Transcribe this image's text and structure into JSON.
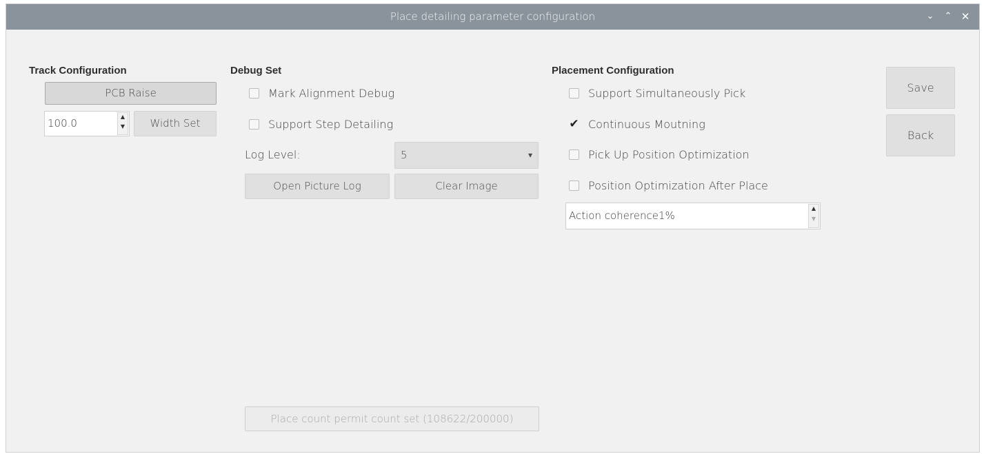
{
  "window": {
    "title": "Place detailing parameter configuration",
    "controls": {
      "minimize": "⌄",
      "maximize": "⌃",
      "close": "✕"
    }
  },
  "track": {
    "heading": "Track Configuration",
    "pcb_raise_label": "PCB Raise",
    "width_value": "100.0",
    "width_set_label": "Width Set"
  },
  "debug": {
    "heading": "Debug Set",
    "mark_alignment_label": "Mark Alignment Debug",
    "mark_alignment_checked": false,
    "step_detailing_label": "Support Step Detailing",
    "step_detailing_checked": false,
    "log_level_label": "Log Level:",
    "log_level_value": "5",
    "open_picture_log_label": "Open Picture Log",
    "clear_image_label": "Clear Image",
    "permit_count_label": "Place count permit count set (108622/200000)"
  },
  "placement": {
    "heading": "Placement Configuration",
    "options": [
      {
        "label": "Support Simultaneously Pick",
        "checked": false
      },
      {
        "label": "Continuous Moutning",
        "checked": true
      },
      {
        "label": "Pick Up Position Optimization",
        "checked": false
      },
      {
        "label": "Position Optimization After Place",
        "checked": false
      }
    ],
    "coherence_value": "Action coherence1%"
  },
  "actions": {
    "save_label": "Save",
    "back_label": "Back"
  },
  "glyphs": {
    "check": "✔",
    "spin_up": "▲",
    "spin_down": "▼",
    "dropdown": "▾"
  }
}
